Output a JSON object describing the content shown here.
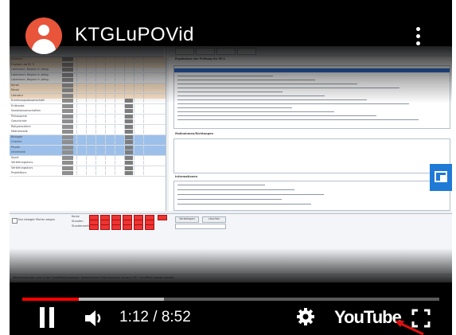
{
  "player": {
    "channel_title": "KTGLuPOVid",
    "current_time": "1:12",
    "duration": "8:52",
    "time_display": "1:12 / 8:52",
    "played_fraction": 0.135,
    "buffered_fraction": 0.34,
    "brand_label": "YouTube",
    "accent_color": "#ff0000",
    "avatar_color": "#e8553a",
    "cast_button_color": "#1f7ad6",
    "icons": {
      "avatar": "avatar-icon",
      "more": "more-vert-icon",
      "cast": "cast-icon",
      "pause": "pause-icon",
      "volume": "volume-icon",
      "settings": "gear-icon",
      "fullscreen": "fullscreen-icon",
      "annotation": "red-arrow-icon"
    }
  },
  "video_frame": {
    "left_rows": [
      "Deutsch",
      "Englisch ab Kl. 5",
      "Lateinisch, Beginn in Jahrg.",
      "Lateinisch, Beginn in Jahrg.",
      "Lateinisch, Beginn in Jahrg.",
      "Kunst",
      "Musik",
      "Literatur",
      "Erziehungswissenschaft",
      "Erdkunde",
      "Sozialwissenschaften",
      "Philosophie",
      "Geschichte",
      "Religionslehre",
      "Mathematik",
      "Biologie",
      "Chemie",
      "Physik",
      "Informatik",
      "Sport",
      "Vertiefungskurs",
      "Vertiefungskurs",
      "Projektkurs"
    ],
    "right_heading": "Ergebnisse der Prüfung für EF.1",
    "section_measures": "Maßnahmen/Richtungen",
    "section_info": "Informationen",
    "bottom_buttons": [
      "Vorbelegen",
      "Löschen"
    ],
    "bottom_checkbox_label": "Nur belegte Fächer zeigen",
    "bottom_field_labels": [
      "Kurse",
      "Stunden",
      "Stundenzahl"
    ],
    "status_text": "Wochenstunden sind in der Qualifikationsphase: Kompensierte Fremdsprache muss in EF.1 schriftlich belegt werden"
  }
}
